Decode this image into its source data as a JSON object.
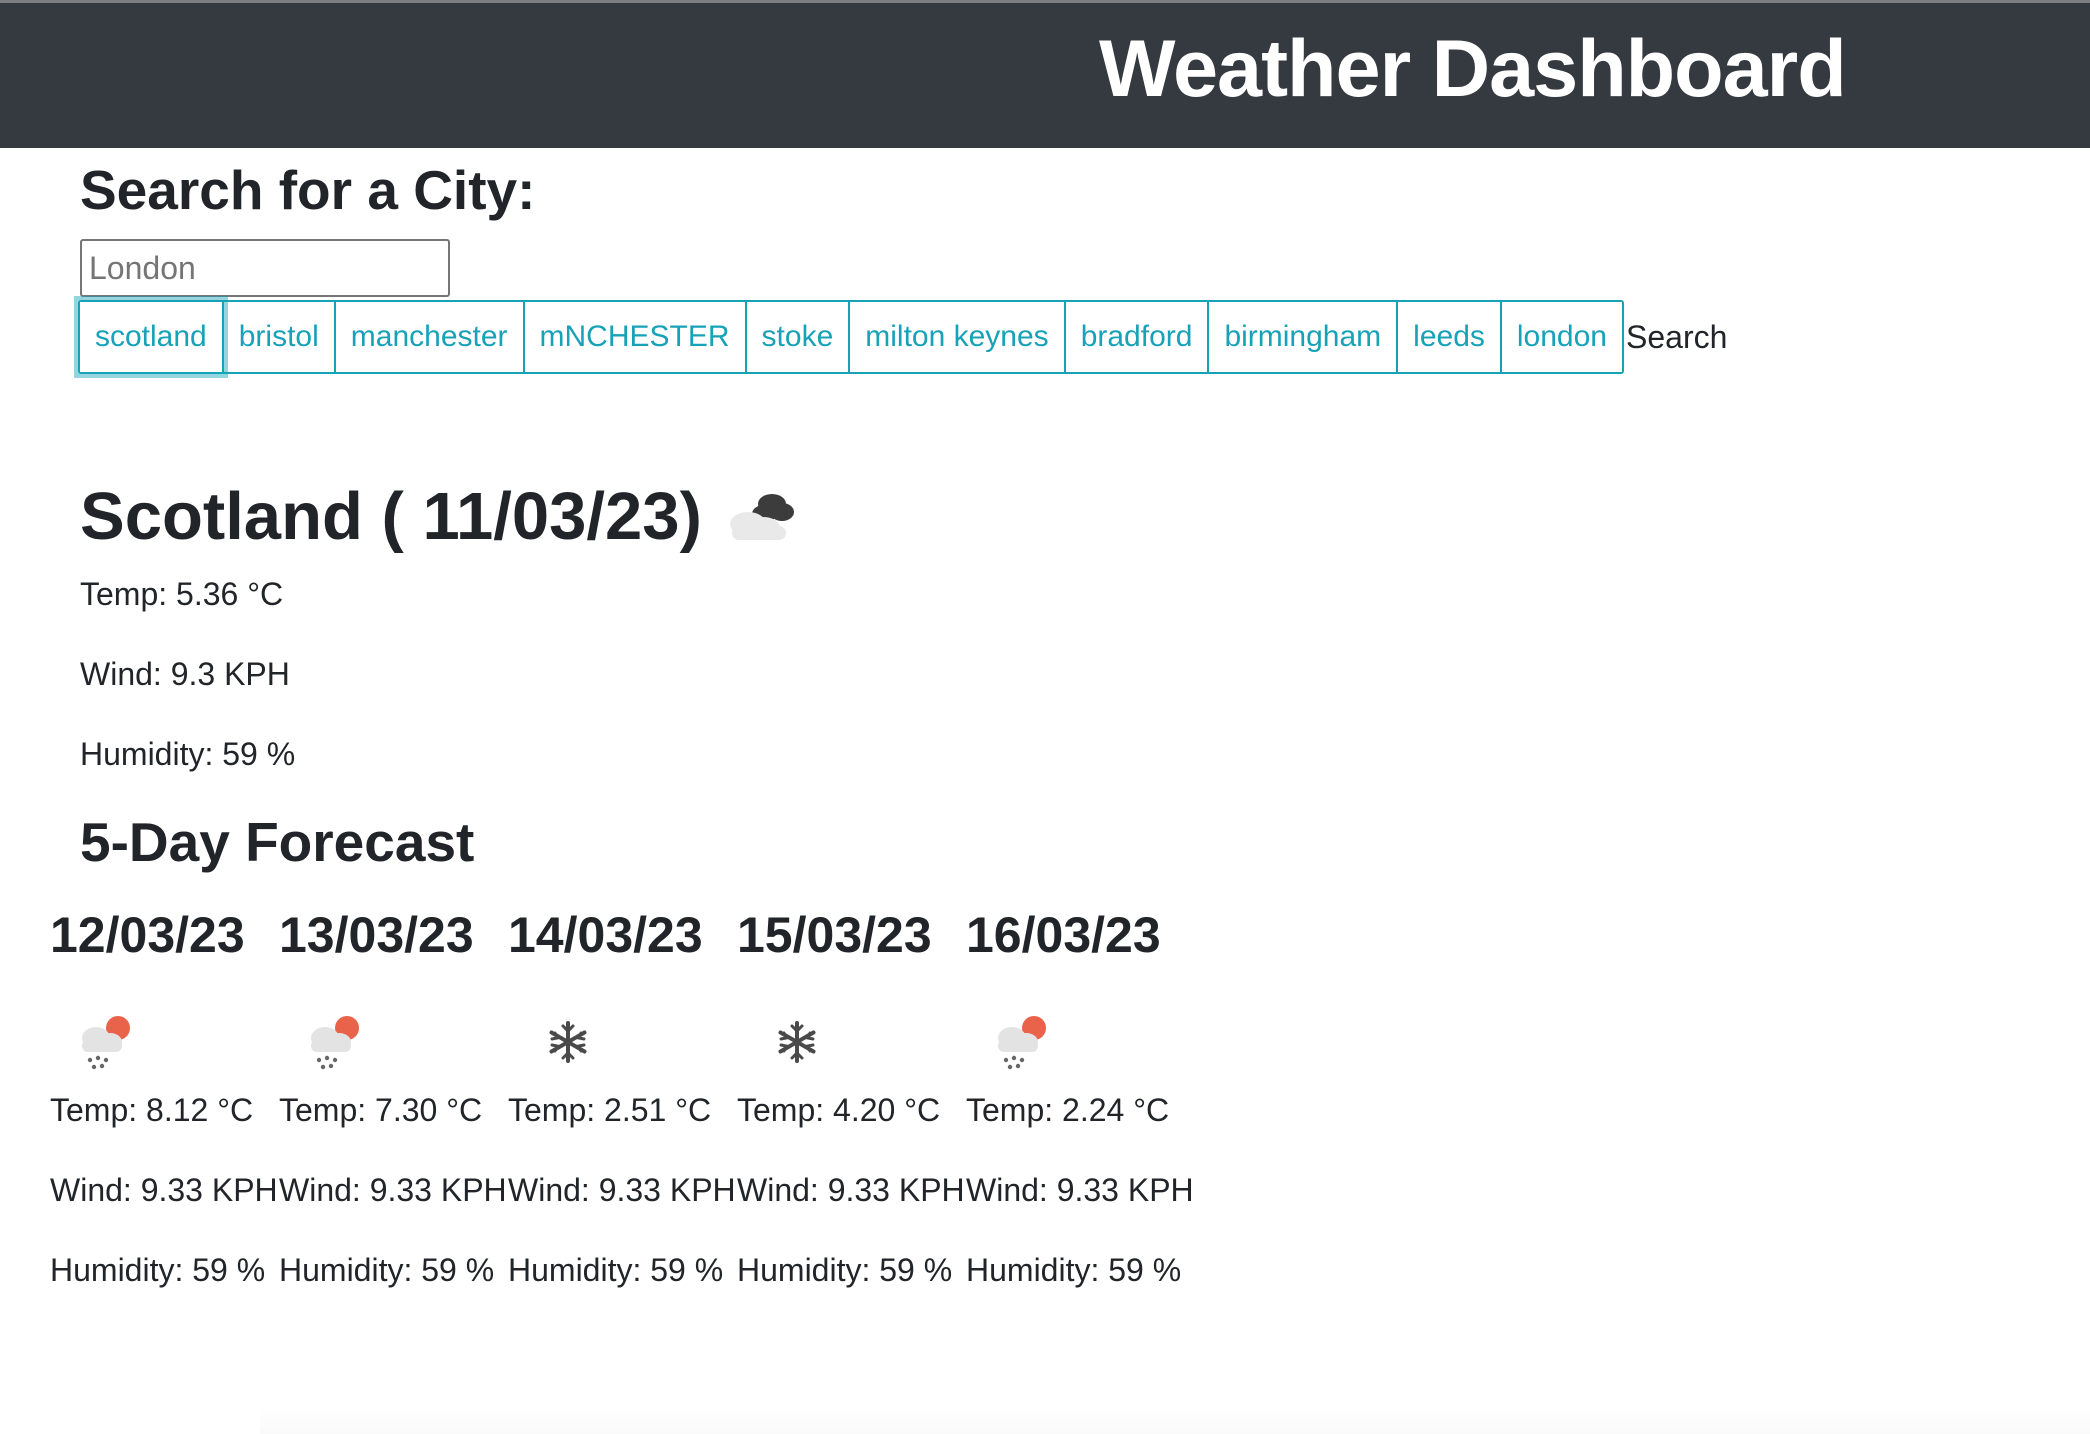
{
  "header": {
    "title": "Weather Dashboard"
  },
  "search": {
    "heading": "Search for a City:",
    "placeholder": "London",
    "button_label": "Search"
  },
  "history": [
    {
      "label": "scotland"
    },
    {
      "label": "bristol"
    },
    {
      "label": "manchester"
    },
    {
      "label": "mNCHESTER"
    },
    {
      "label": "stoke"
    },
    {
      "label": "milton keynes"
    },
    {
      "label": "bradford"
    },
    {
      "label": "birmingham"
    },
    {
      "label": "leeds"
    },
    {
      "label": "london"
    }
  ],
  "current": {
    "title": "Scotland ( 11/03/23)",
    "icon": "broken-clouds-icon",
    "temp": "Temp: 5.36 °C",
    "wind": "Wind: 9.3 KPH",
    "humidity": "Humidity: 59 %"
  },
  "forecast": {
    "heading": "5-Day Forecast",
    "days": [
      {
        "date": "12/03/23",
        "icon": "sun-rain-icon",
        "temp": "Temp: 8.12 °C",
        "wind": "Wind: 9.33 KPH",
        "humidity": "Humidity: 59 %"
      },
      {
        "date": "13/03/23",
        "icon": "sun-rain-icon",
        "temp": "Temp: 7.30 °C",
        "wind": "Wind: 9.33 KPH",
        "humidity": "Humidity: 59 %"
      },
      {
        "date": "14/03/23",
        "icon": "snowflake-icon",
        "temp": "Temp: 2.51 °C",
        "wind": "Wind: 9.33 KPH",
        "humidity": "Humidity: 59 %"
      },
      {
        "date": "15/03/23",
        "icon": "snowflake-icon",
        "temp": "Temp: 4.20 °C",
        "wind": "Wind: 9.33 KPH",
        "humidity": "Humidity: 59 %"
      },
      {
        "date": "16/03/23",
        "icon": "sun-rain-icon",
        "temp": "Temp: 2.24 °C",
        "wind": "Wind: 9.33 KPH",
        "humidity": "Humidity: 59 %"
      }
    ]
  },
  "colors": {
    "header_bg": "#343a40",
    "accent": "#17a2b8",
    "sun": "#e8634a"
  }
}
